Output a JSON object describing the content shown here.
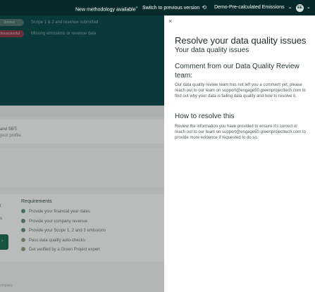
{
  "topbar": {
    "new_methodology": "New methodology available",
    "new_badge": "®",
    "switch_version": "Switch to previous version",
    "organisation": "Demo-Pre-calculated Emissions",
    "avatar_initials": "EE"
  },
  "background": {
    "status_rows": [
      {
        "badge": "Started",
        "text": "Scope 1 & 2 and revenue submitted",
        "badge_color": "#51706b"
      },
      {
        "badge": "Unsuccessful",
        "text": "Missing emissions or revenue data",
        "badge_color": "#8a3a4a"
      }
    ],
    "card_title": "and SBTi",
    "card_subtitle": "your profile.",
    "mini_title": "t",
    "mini_sub": "s",
    "requirements_title": "Requirements",
    "requirements": [
      "Provide your financial year dates",
      "Provide your company revenue",
      "Provide your Scope 1, 2 and 3 emissions",
      "Pass data quality auto-checks",
      "Get verified by a Green Project expert"
    ],
    "footer": "ompany"
  },
  "drawer": {
    "title": "Resolve your data quality issues",
    "subtitle": "Your data quality issues",
    "comment_heading": "Comment from our Data Quality Review team:",
    "comment_body": "Our data quality review team has not left you a comment yet; please reach out to our team on support@engage50.greenprojecttech.com to find out why your data is failing data quality and how to resolve it.",
    "resolve_heading": "How to resolve this",
    "resolve_body": "Review the information you have provided to ensure it's correct or reach out to our team on support@engage50.greenprojecttech.com to provide more evidence if requested to do so."
  },
  "colors": {
    "topbar_bg": "#062a2b",
    "dark_panel": "#0d4a4a",
    "accent_green": "#5a8c78"
  }
}
